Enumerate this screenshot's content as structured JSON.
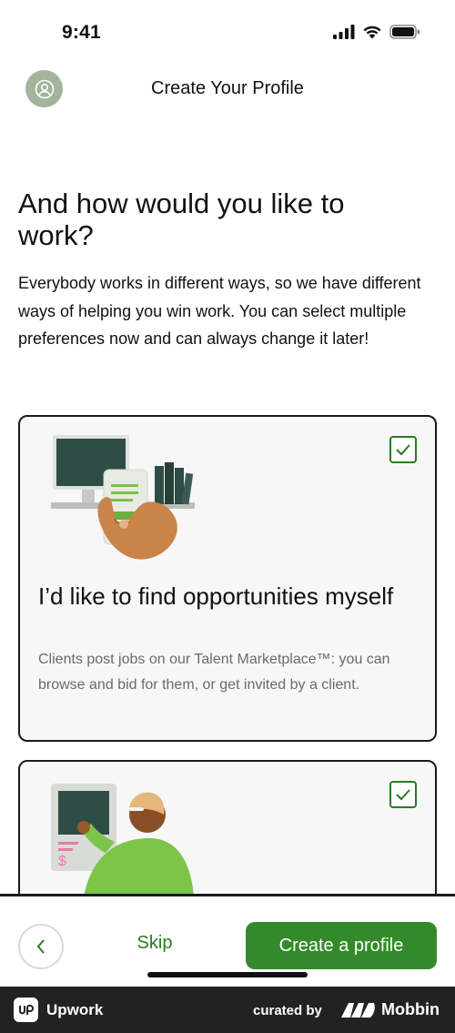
{
  "status_bar": {
    "time": "9:41",
    "icons": [
      "cellular-signal-icon",
      "wifi-icon",
      "battery-icon"
    ]
  },
  "header": {
    "title": "Create Your Profile",
    "avatar_icon": "user-circle-icon"
  },
  "main": {
    "heading": "And how would you like to work?",
    "description": "Everybody works in different ways, so we have different ways of helping you win work. You can select multiple preferences now and can always change it later!"
  },
  "options": [
    {
      "title": "I’d like to find opportunities myself",
      "description": "Clients post jobs on our Talent Marketplace™: you can browse and bid for them, or get invited by a client.",
      "checked": true,
      "illustration": "phone-in-hand-illustration"
    },
    {
      "title": "",
      "description": "",
      "checked": true,
      "illustration": "person-at-kiosk-illustration"
    }
  ],
  "bottom_bar": {
    "back_icon": "chevron-left-icon",
    "skip_label": "Skip",
    "create_label": "Create a profile"
  },
  "footer": {
    "app_name": "Upwork",
    "curated_by": "curated by",
    "brand": "Mobbin"
  },
  "colors": {
    "accent_green": "#348a2a",
    "text_green": "#2b7a23",
    "avatar_bg": "#a3b39c",
    "footer_bg": "#222222"
  }
}
